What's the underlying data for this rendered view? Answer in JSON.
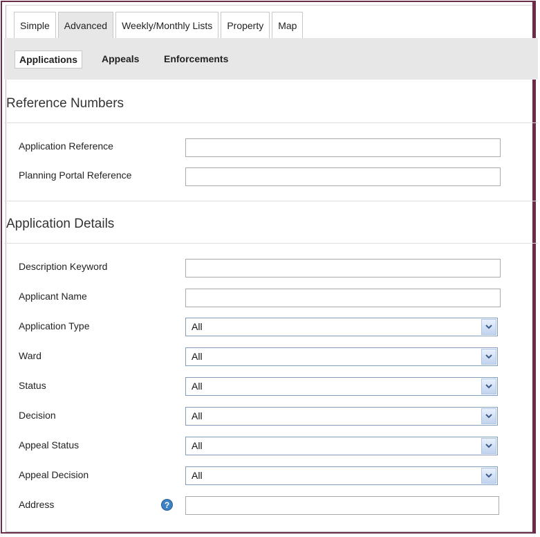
{
  "tabs": [
    {
      "label": "Simple",
      "active": false
    },
    {
      "label": "Advanced",
      "active": true
    },
    {
      "label": "Weekly/Monthly Lists",
      "active": false
    },
    {
      "label": "Property",
      "active": false
    },
    {
      "label": "Map",
      "active": false
    }
  ],
  "subnav": {
    "applications": "Applications",
    "appeals": "Appeals",
    "enforcements": "Enforcements",
    "active": "Applications"
  },
  "reference_numbers": {
    "title": "Reference Numbers",
    "application_reference": {
      "label": "Application Reference",
      "value": ""
    },
    "planning_portal_reference": {
      "label": "Planning Portal Reference",
      "value": ""
    }
  },
  "application_details": {
    "title": "Application Details",
    "description_keyword": {
      "label": "Description Keyword",
      "value": ""
    },
    "applicant_name": {
      "label": "Applicant Name",
      "value": ""
    },
    "application_type": {
      "label": "Application Type",
      "selected": "All"
    },
    "ward": {
      "label": "Ward",
      "selected": "All"
    },
    "status": {
      "label": "Status",
      "selected": "All"
    },
    "decision": {
      "label": "Decision",
      "selected": "All"
    },
    "appeal_status": {
      "label": "Appeal Status",
      "selected": "All"
    },
    "appeal_decision": {
      "label": "Appeal Decision",
      "selected": "All"
    },
    "address": {
      "label": "Address",
      "value": ""
    }
  },
  "icons": {
    "help": "help-icon",
    "dropdown": "chevron-down-icon"
  },
  "colors": {
    "frame": "#6b2c4a",
    "subnav_bg": "#e7e7e7",
    "help_icon": "#3d82c4"
  }
}
